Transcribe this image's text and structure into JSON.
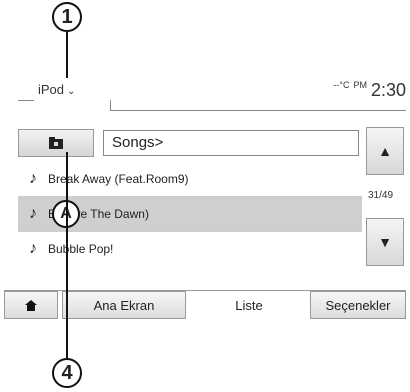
{
  "callouts": {
    "top": "1",
    "bottom": "4",
    "item": "A"
  },
  "header": {
    "source_label": "iPod",
    "source_chevron": "⌄",
    "temp": "--°C",
    "ampm": "PM",
    "clock": "2:30"
  },
  "browser": {
    "path": "Songs>",
    "counter": "31/49"
  },
  "songs": [
    {
      "title": "Break Away (Feat.Room9)"
    },
    {
      "title": "BT  fore The Dawn)"
    },
    {
      "title": "Bubble Pop!"
    }
  ],
  "scroll": {
    "up": "▲",
    "down": "▼"
  },
  "tabs": {
    "home_icon": "home-icon",
    "home_label": "Ana Ekran",
    "list_label": "Liste",
    "options_label": "Seçenekler"
  },
  "colors": {
    "selected_row": "#cfcfcf",
    "button_top": "#f2f2f2",
    "button_bottom": "#d6d6d6"
  }
}
